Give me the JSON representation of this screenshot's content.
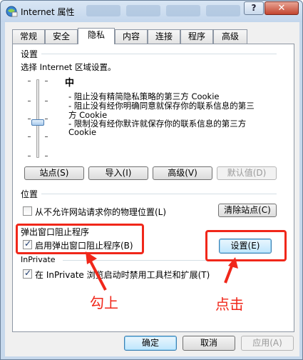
{
  "window": {
    "title": "Internet 属性",
    "icon": "internet-options-icon",
    "help_label": "?",
    "close_label": "✕"
  },
  "tabs": [
    {
      "label": "常规"
    },
    {
      "label": "安全"
    },
    {
      "label": "隐私",
      "active": true
    },
    {
      "label": "内容"
    },
    {
      "label": "连接"
    },
    {
      "label": "程序"
    },
    {
      "label": "高级"
    }
  ],
  "settings_section": {
    "heading": "设置",
    "instruction": "选择 Internet 区域设置。",
    "level_title": "中",
    "desc_1a": "- 阻止没有精简隐私策略的第三方 Cookie",
    "desc_2a": "- 阻止没有经你明确同意就保存你的联系信息的第三",
    "desc_2b": "方 Cookie",
    "desc_3a": "- 限制没有经你默许就保存你的联系信息的第三方",
    "desc_3b": "Cookie",
    "buttons": {
      "sites": "站点(S)",
      "import": "导入(I)",
      "advanced": "高级(V)",
      "default": "默认值(D)"
    }
  },
  "location_section": {
    "heading": "位置",
    "checkbox_label": "从不允许网站请求你的物理位置(L)",
    "checked": false,
    "clear_button": "清除站点(C)"
  },
  "popup_section": {
    "heading": "弹出窗口阻止程序",
    "checkbox_label": "启用弹出窗口阻止程序(B)",
    "checked": true,
    "settings_button": "设置(E)"
  },
  "inprivate_section": {
    "heading": "InPrivate",
    "checkbox_label": "在 InPrivate 浏览启动时禁用工具栏和扩展(T)",
    "checked": true
  },
  "annotations": {
    "check_label": "勾上",
    "click_label": "点击",
    "color": "#f0271a"
  },
  "footer": {
    "ok": "确定",
    "cancel": "取消",
    "apply": "应用(A)"
  }
}
